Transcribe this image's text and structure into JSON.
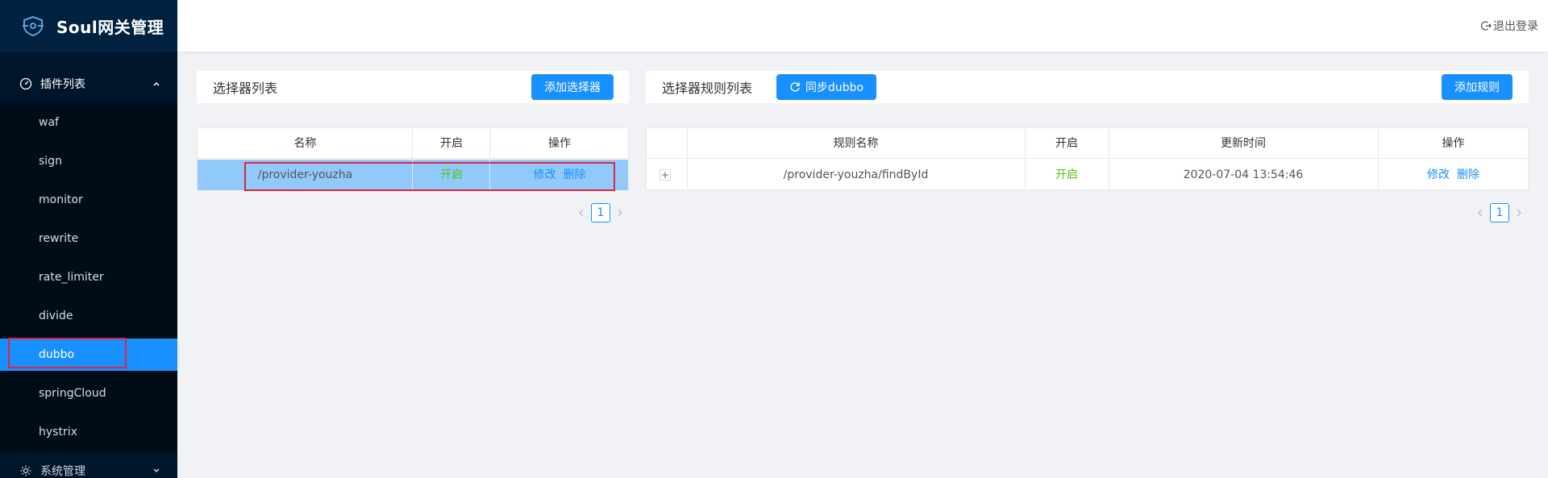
{
  "app": {
    "title": "Soul网关管理"
  },
  "header": {
    "logout_label": "退出登录"
  },
  "sidebar": {
    "plugins_group_label": "插件列表",
    "system_group_label": "系统管理",
    "items": [
      {
        "label": "waf"
      },
      {
        "label": "sign"
      },
      {
        "label": "monitor"
      },
      {
        "label": "rewrite"
      },
      {
        "label": "rate_limiter"
      },
      {
        "label": "divide"
      },
      {
        "label": "dubbo"
      },
      {
        "label": "springCloud"
      },
      {
        "label": "hystrix"
      }
    ],
    "active_item": "dubbo"
  },
  "selector_panel": {
    "title": "选择器列表",
    "add_button_label": "添加选择器",
    "columns": [
      "名称",
      "开启",
      "操作"
    ],
    "rows": [
      {
        "name": "/provider-youzha",
        "enabled": "开启",
        "edit_label": "修改",
        "delete_label": "删除"
      }
    ],
    "pagination": {
      "current_page": "1"
    }
  },
  "rule_panel": {
    "title": "选择器规则列表",
    "sync_button_label": "同步dubbo",
    "add_button_label": "添加规则",
    "columns": [
      "",
      "规则名称",
      "开启",
      "更新时间",
      "操作"
    ],
    "rows": [
      {
        "expand": "+",
        "name": "/provider-youzha/findById",
        "enabled": "开启",
        "updated_at": "2020-07-04 13:54:46",
        "edit_label": "修改",
        "delete_label": "删除"
      }
    ],
    "pagination": {
      "current_page": "1"
    }
  },
  "colors": {
    "sidebar_bg": "#001529",
    "accent": "#1890ff",
    "enabled_green": "#52c41a",
    "highlight_red": "#e0243f",
    "selected_row": "#91c9fb"
  }
}
